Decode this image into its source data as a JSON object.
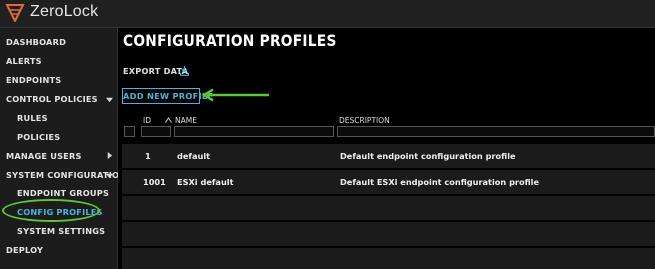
{
  "app": {
    "title": "ZeroLock",
    "accent": "#4fb3d9",
    "logo_color": "#e06a3a",
    "annotation_color": "#5cc63a"
  },
  "sidebar": {
    "items": [
      {
        "label": "DASHBOARD"
      },
      {
        "label": "ALERTS"
      },
      {
        "label": "ENDPOINTS"
      },
      {
        "label": "CONTROL POLICIES",
        "icon": "chevron-down-icon"
      },
      {
        "label": "RULES"
      },
      {
        "label": "POLICIES"
      },
      {
        "label": "MANAGE USERS",
        "icon": "chevron-right-icon"
      },
      {
        "label": "SYSTEM CONFIGURATION",
        "icon": "chevron-down-icon"
      },
      {
        "label": "ENDPOINT GROUPS"
      },
      {
        "label": "CONFIG PROFILES",
        "active": true
      },
      {
        "label": "SYSTEM SETTINGS"
      },
      {
        "label": "DEPLOY"
      }
    ]
  },
  "main": {
    "title": "CONFIGURATION PROFILES",
    "export_label": "EXPORT DATA",
    "add_button_label": "ADD NEW PROFILE",
    "table": {
      "columns": [
        "ID",
        "NAME",
        "DESCRIPTION"
      ],
      "rows": [
        {
          "id": "1",
          "name": "default",
          "description": "Default endpoint configuration profile"
        },
        {
          "id": "1001",
          "name": "ESXi default",
          "description": "Default ESXi endpoint configuration profile"
        }
      ]
    }
  }
}
